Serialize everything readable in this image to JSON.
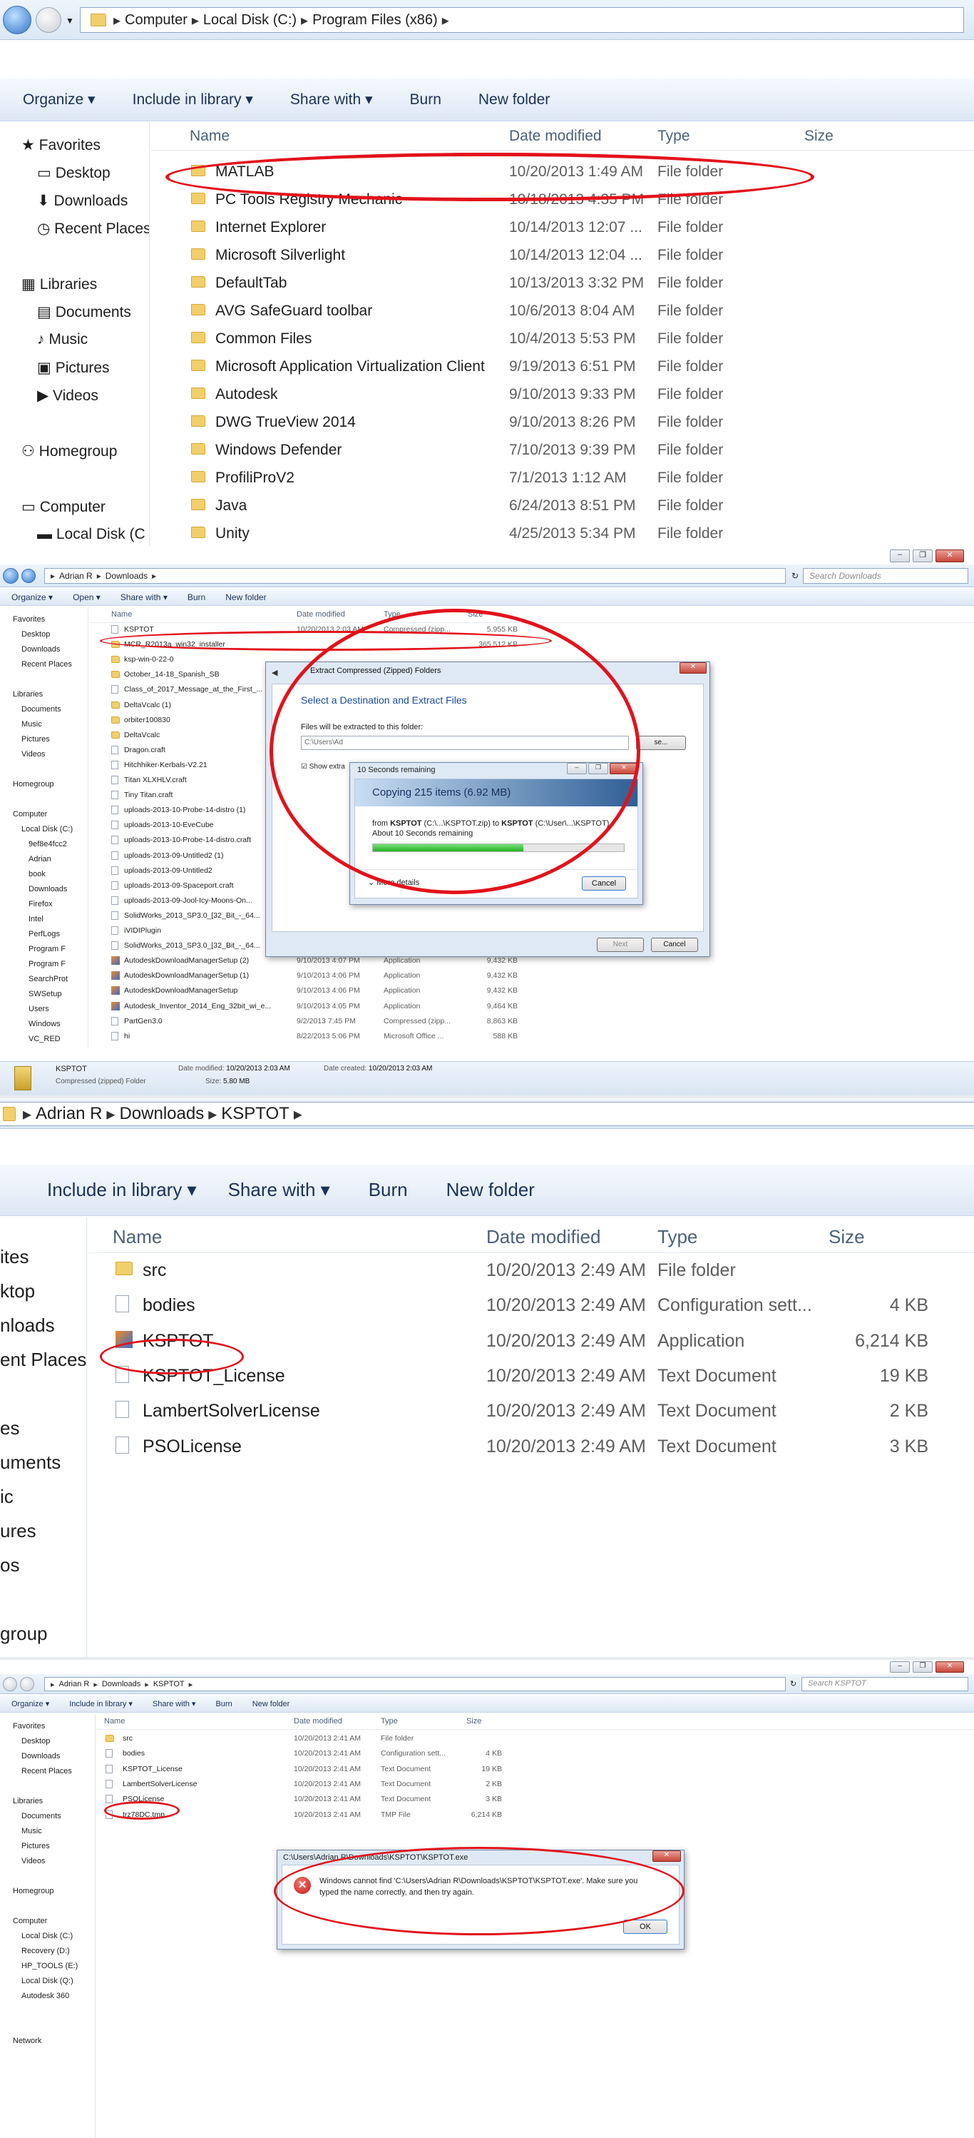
{
  "p1": {
    "breadcrumb": [
      "Computer",
      "Local Disk (C:)",
      "Program Files (x86)"
    ],
    "toolbar": [
      "Organize",
      "Include in library",
      "Share with",
      "Burn",
      "New folder"
    ],
    "columns": [
      "Name",
      "Date modified",
      "Type",
      "Size"
    ],
    "nav": [
      "Favorites",
      "Desktop",
      "Downloads",
      "Recent Places",
      "Libraries",
      "Documents",
      "Music",
      "Pictures",
      "Videos",
      "Homegroup",
      "Computer",
      "Local Disk (C"
    ],
    "rows": [
      {
        "name": "MATLAB",
        "date": "10/20/2013 1:49 AM",
        "type": "File folder"
      },
      {
        "name": "PC Tools Registry Mechanic",
        "date": "10/18/2013 4:35 PM",
        "type": "File folder"
      },
      {
        "name": "Internet Explorer",
        "date": "10/14/2013 12:07 ...",
        "type": "File folder"
      },
      {
        "name": "Microsoft Silverlight",
        "date": "10/14/2013 12:04 ...",
        "type": "File folder"
      },
      {
        "name": "DefaultTab",
        "date": "10/13/2013 3:32 PM",
        "type": "File folder"
      },
      {
        "name": "AVG SafeGuard toolbar",
        "date": "10/6/2013 8:04 AM",
        "type": "File folder"
      },
      {
        "name": "Common Files",
        "date": "10/4/2013 5:53 PM",
        "type": "File folder"
      },
      {
        "name": "Microsoft Application Virtualization Client",
        "date": "9/19/2013 6:51 PM",
        "type": "File folder"
      },
      {
        "name": "Autodesk",
        "date": "9/10/2013 9:33 PM",
        "type": "File folder"
      },
      {
        "name": "DWG TrueView 2014",
        "date": "9/10/2013 8:26 PM",
        "type": "File folder"
      },
      {
        "name": "Windows Defender",
        "date": "7/10/2013 9:39 PM",
        "type": "File folder"
      },
      {
        "name": "ProfiliProV2",
        "date": "7/1/2013 1:12 AM",
        "type": "File folder"
      },
      {
        "name": "Java",
        "date": "6/24/2013 8:51 PM",
        "type": "File folder"
      },
      {
        "name": "Unity",
        "date": "4/25/2013 5:34 PM",
        "type": "File folder"
      }
    ]
  },
  "p2": {
    "breadcrumb": [
      "Adrian R",
      "Downloads"
    ],
    "search_placeholder": "Search Downloads",
    "toolbar": [
      "Organize",
      "Open",
      "Share with",
      "Burn",
      "New folder"
    ],
    "columns": [
      "Name",
      "Date modified",
      "Type",
      "Size"
    ],
    "nav": [
      "Favorites",
      "Desktop",
      "Downloads",
      "Recent Places",
      "Libraries",
      "Documents",
      "Music",
      "Pictures",
      "Videos",
      "Homegroup",
      "Computer",
      "Local Disk (C:)",
      "9ef8e4fcc2",
      "Adrian",
      "book",
      "Downloads",
      "Firefox",
      "Intel",
      "PerfLogs",
      "Program F",
      "Program F",
      "SearchProt",
      "SWSetup",
      "Users",
      "Windows",
      "VC_RED"
    ],
    "rows": [
      {
        "name": "KSPTOT",
        "date": "10/20/2013 2:03 AM",
        "type": "Compressed (zipp...",
        "size": "5,955 KB"
      },
      {
        "name": "MCR_R2013a_win32_installer",
        "date": "",
        "type": "",
        "size": "365,512 KB"
      },
      {
        "name": "ksp-win-0-22-0",
        "date": "",
        "type": "",
        "size": ""
      },
      {
        "name": "October_14-18_Spanish_SB",
        "date": "",
        "type": "",
        "size": ""
      },
      {
        "name": "Class_of_2017_Message_at_the_First_...",
        "date": "",
        "type": "",
        "size": ""
      },
      {
        "name": "DeltaVcalc (1)",
        "date": "",
        "type": "",
        "size": ""
      },
      {
        "name": "orbiter100830",
        "date": "",
        "type": "",
        "size": ""
      },
      {
        "name": "DeltaVcalc",
        "date": "",
        "type": "",
        "size": ""
      },
      {
        "name": "Dragon.craft",
        "date": "",
        "type": "",
        "size": ""
      },
      {
        "name": "Hitchhiker-Kerbals-V2.21",
        "date": "",
        "type": "",
        "size": ""
      },
      {
        "name": "Titan XLXHLV.craft",
        "date": "",
        "type": "",
        "size": ""
      },
      {
        "name": "Tiny Titan.craft",
        "date": "",
        "type": "",
        "size": ""
      },
      {
        "name": "uploads-2013-10-Probe-14-distro (1)",
        "date": "",
        "type": "",
        "size": ""
      },
      {
        "name": "uploads-2013-10-EveCube",
        "date": "",
        "type": "",
        "size": ""
      },
      {
        "name": "uploads-2013-10-Probe-14-distro.craft",
        "date": "",
        "type": "",
        "size": ""
      },
      {
        "name": "uploads-2013-09-Untitled2 (1)",
        "date": "",
        "type": "",
        "size": ""
      },
      {
        "name": "uploads-2013-09-Untitled2",
        "date": "",
        "type": "",
        "size": ""
      },
      {
        "name": "uploads-2013-09-Spaceport.craft",
        "date": "",
        "type": "",
        "size": ""
      },
      {
        "name": "uploads-2013-09-Jool-Icy-Moons-On...",
        "date": "",
        "type": "",
        "size": ""
      },
      {
        "name": "SolidWorks_2013_SP3.0_[32_Bit_-_64...",
        "date": "",
        "type": "",
        "size": ""
      },
      {
        "name": "iVIDIPlugin",
        "date": "",
        "type": "",
        "size": ""
      },
      {
        "name": "SolidWorks_2013_SP3.0_[32_Bit_-_64...",
        "date": "",
        "type": "",
        "size": ""
      },
      {
        "name": "AutodeskDownloadManagerSetup (2)",
        "date": "9/10/2013 4:07 PM",
        "type": "Application",
        "size": "9,432 KB"
      },
      {
        "name": "AutodeskDownloadManagerSetup (1)",
        "date": "9/10/2013 4:06 PM",
        "type": "Application",
        "size": "9,432 KB"
      },
      {
        "name": "AutodeskDownloadManagerSetup",
        "date": "9/10/2013 4:06 PM",
        "type": "Application",
        "size": "9,432 KB"
      },
      {
        "name": "Autodesk_Inventor_2014_Eng_32bit_wi_e...",
        "date": "9/10/2013 4:05 PM",
        "type": "Application",
        "size": "9,464 KB"
      },
      {
        "name": "PartGen3.0",
        "date": "9/2/2013 7:45 PM",
        "type": "Compressed (zipp...",
        "size": "8,863 KB"
      },
      {
        "name": "hi",
        "date": "8/22/2013 5:06 PM",
        "type": "Microsoft Office ...",
        "size": "588 KB"
      }
    ],
    "extract_dialog": {
      "title": "Extract Compressed (Zipped) Folders",
      "heading": "Select a Destination and Extract Files",
      "label": "Files will be extracted to this folder:",
      "path": "C:\\Users\\Ad",
      "browse": "se...",
      "show_extracted": "Show extra",
      "next": "Next",
      "cancel": "Cancel"
    },
    "copy_dialog": {
      "title": "10 Seconds remaining",
      "heading": "Copying 215 items (6.92 MB)",
      "from_prefix": "from",
      "from_bold": "KSPTOT",
      "from_path": "(C:\\...\\KSPTOT.zip)",
      "to_prefix": "to",
      "to_bold": "KSPTOT",
      "to_path": "(C:\\User\\...\\KSPTOT)",
      "remaining": "About 10 Seconds remaining",
      "progress_fraction": 0.6,
      "more_details": "More details",
      "cancel": "Cancel"
    },
    "details": {
      "name": "KSPTOT",
      "kind": "Compressed (zipped) Folder",
      "modified_label": "Date modified:",
      "modified": "10/20/2013 2:03 AM",
      "created_label": "Date created:",
      "created": "10/20/2013 2:03 AM",
      "size_label": "Size:",
      "size": "5.80 MB"
    }
  },
  "p3": {
    "breadcrumb": [
      "Adrian R",
      "Downloads",
      "KSPTOT"
    ],
    "toolbar": [
      "Include in library",
      "Share with",
      "Burn",
      "New folder"
    ],
    "columns": [
      "Name",
      "Date modified",
      "Type",
      "Size"
    ],
    "nav": [
      "ites",
      "ktop",
      "nloads",
      "ent Places",
      "es",
      "uments",
      "ic",
      "ures",
      "os",
      "group"
    ],
    "rows": [
      {
        "name": "src",
        "date": "10/20/2013 2:49 AM",
        "type": "File folder",
        "size": ""
      },
      {
        "name": "bodies",
        "date": "10/20/2013 2:49 AM",
        "type": "Configuration sett...",
        "size": "4 KB"
      },
      {
        "name": "KSPTOT",
        "date": "10/20/2013 2:49 AM",
        "type": "Application",
        "size": "6,214 KB"
      },
      {
        "name": "KSPTOT_License",
        "date": "10/20/2013 2:49 AM",
        "type": "Text Document",
        "size": "19 KB"
      },
      {
        "name": "LambertSolverLicense",
        "date": "10/20/2013 2:49 AM",
        "type": "Text Document",
        "size": "2 KB"
      },
      {
        "name": "PSOLicense",
        "date": "10/20/2013 2:49 AM",
        "type": "Text Document",
        "size": "3 KB"
      }
    ]
  },
  "p4": {
    "breadcrumb": [
      "Adrian R",
      "Downloads",
      "KSPTOT"
    ],
    "search_placeholder": "Search KSPTOT",
    "toolbar": [
      "Organize",
      "Include in library",
      "Share with",
      "Burn",
      "New folder"
    ],
    "columns": [
      "Name",
      "Date modified",
      "Type",
      "Size"
    ],
    "nav": [
      "Favorites",
      "Desktop",
      "Downloads",
      "Recent Places",
      "Libraries",
      "Documents",
      "Music",
      "Pictures",
      "Videos",
      "Homegroup",
      "Computer",
      "Local Disk (C:)",
      "Recovery (D:)",
      "HP_TOOLS (E:)",
      "Local Disk (Q:)",
      "Autodesk 360",
      "Network"
    ],
    "rows": [
      {
        "name": "src",
        "date": "10/20/2013 2:41 AM",
        "type": "File folder",
        "size": ""
      },
      {
        "name": "bodies",
        "date": "10/20/2013 2:41 AM",
        "type": "Configuration sett...",
        "size": "4 KB"
      },
      {
        "name": "KSPTOT_License",
        "date": "10/20/2013 2:41 AM",
        "type": "Text Document",
        "size": "19 KB"
      },
      {
        "name": "LambertSolverLicense",
        "date": "10/20/2013 2:41 AM",
        "type": "Text Document",
        "size": "2 KB"
      },
      {
        "name": "PSOLicense",
        "date": "10/20/2013 2:41 AM",
        "type": "Text Document",
        "size": "3 KB"
      },
      {
        "name": "trz78DC.tmp",
        "date": "10/20/2013 2:41 AM",
        "type": "TMP File",
        "size": "6,214 KB"
      }
    ],
    "error_dialog": {
      "title": "C:\\Users\\Adrian R\\Downloads\\KSPTOT\\KSPTOT.exe",
      "message": "Windows cannot find 'C:\\Users\\Adrian R\\Downloads\\KSPTOT\\KSPTOT.exe'. Make sure you typed the name correctly, and then try again.",
      "ok": "OK"
    }
  },
  "colors": {
    "accent": "#1c3258",
    "highlight_ellipse": "#e2121b",
    "folder": "#f1cf6b",
    "progress": "#23b123"
  }
}
